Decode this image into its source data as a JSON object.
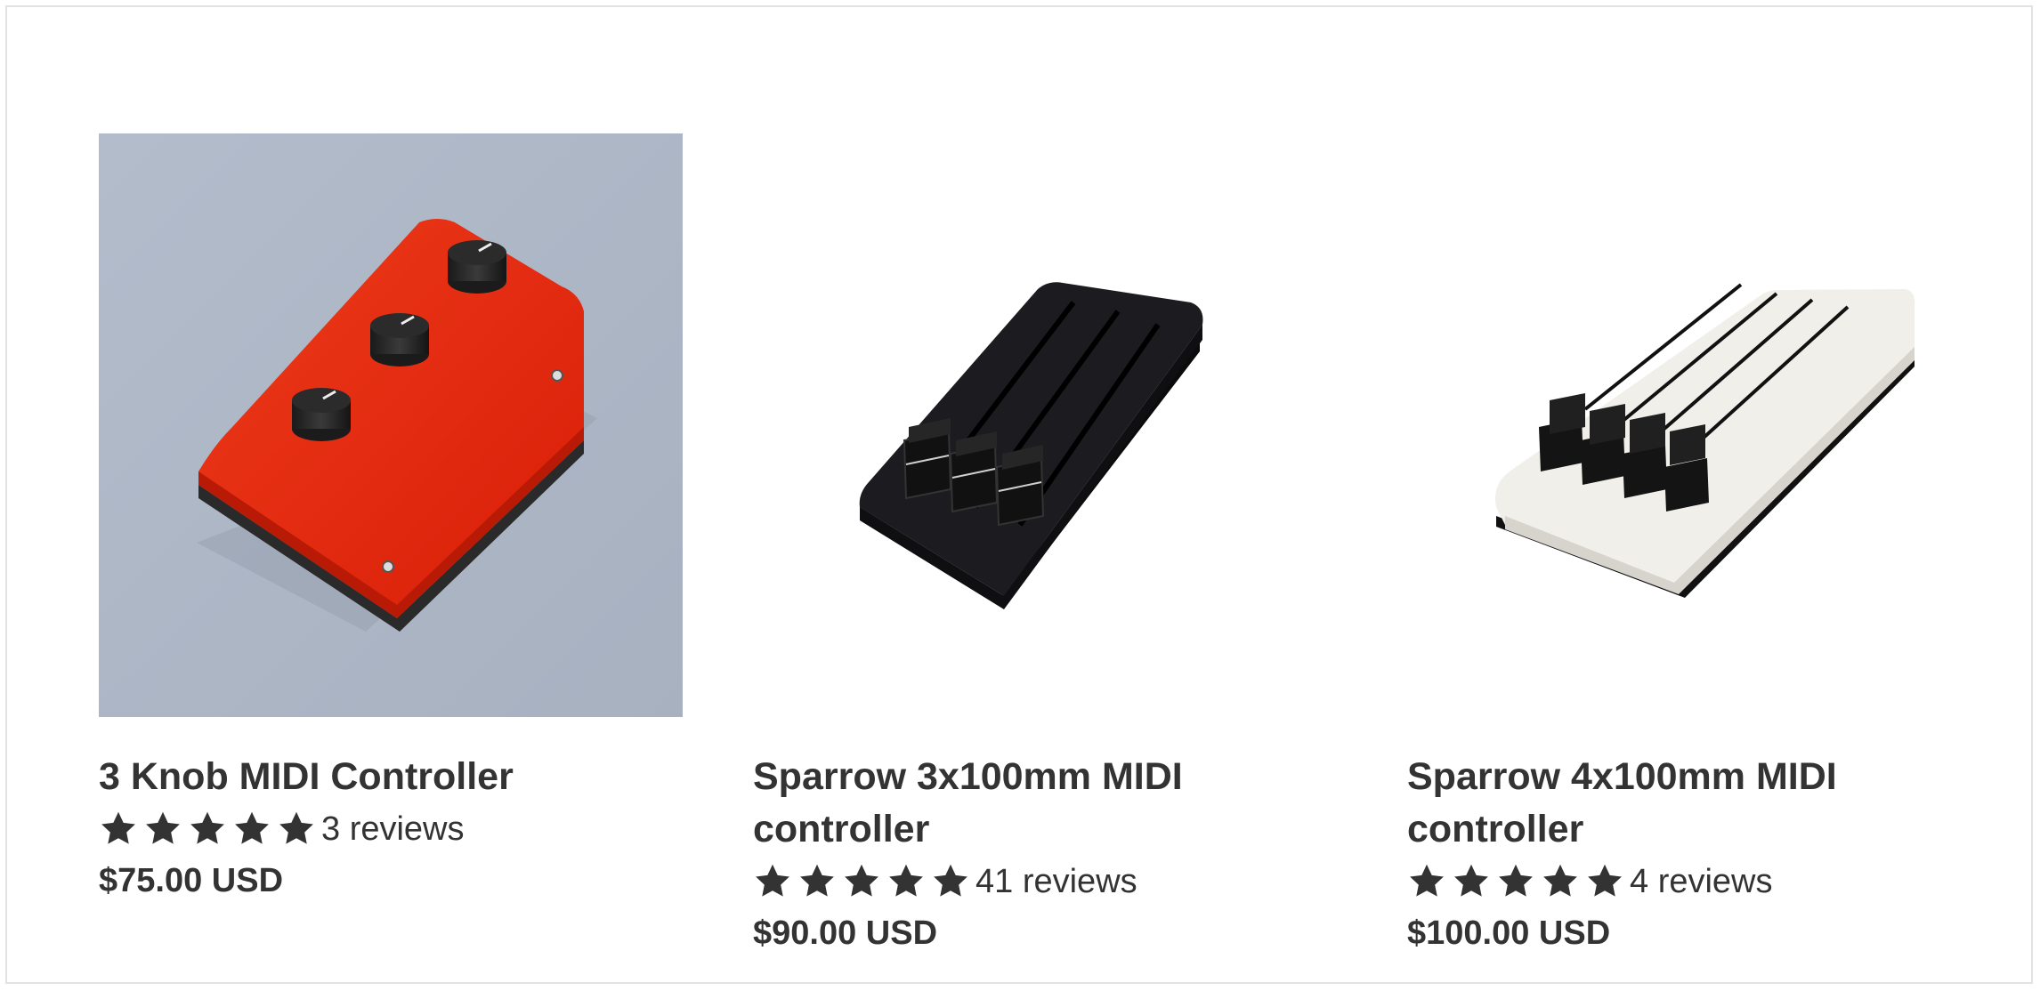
{
  "products": [
    {
      "title": "3 Knob MIDI Controller",
      "rating": 5,
      "reviews_label": "3 reviews",
      "price": "$75.00 USD",
      "image_icon": "red-knob-controller-image"
    },
    {
      "title": "Sparrow 3x100mm MIDI controller",
      "rating": 5,
      "reviews_label": "41 reviews",
      "price": "$90.00 USD",
      "image_icon": "black-fader-controller-image"
    },
    {
      "title": "Sparrow 4x100mm MIDI controller",
      "rating": 5,
      "reviews_label": "4 reviews",
      "price": "$100.00 USD",
      "image_icon": "white-fader-controller-image"
    }
  ],
  "colors": {
    "text": "#333333",
    "star": "#333333",
    "border": "#e2e2e2",
    "image_bg_1": "#aeb6c4",
    "red_body": "#e2240c"
  }
}
